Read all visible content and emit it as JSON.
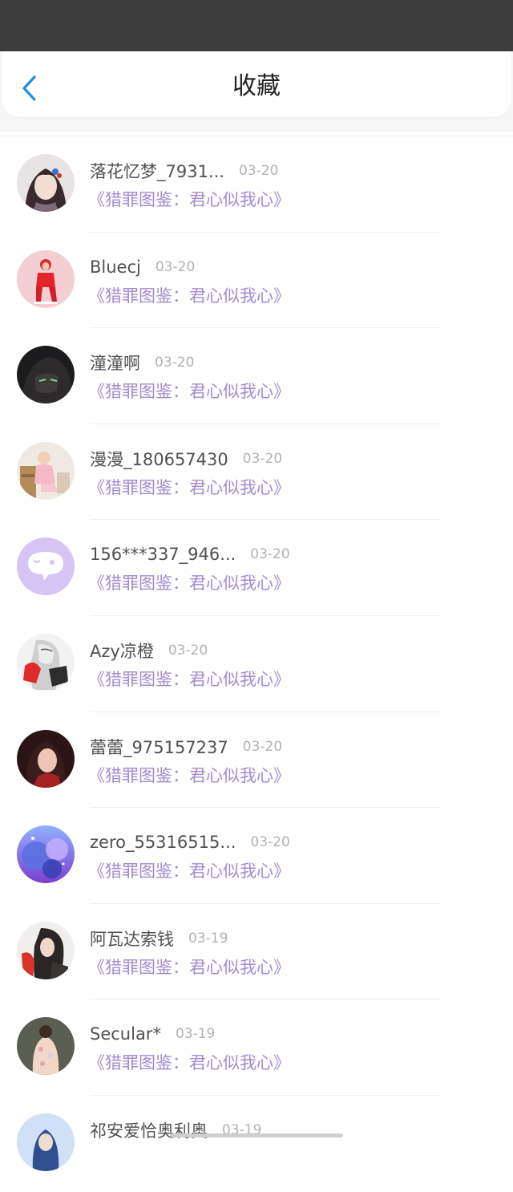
{
  "header": {
    "title": "收藏"
  },
  "colors": {
    "accent": "#1e90e8",
    "link": "#a48bd0",
    "status_bar": "#3d3d3d"
  },
  "items": [
    {
      "name": "落花忆梦_7931...",
      "date": "03-20",
      "book": "《猎罪图鉴：君心似我心》",
      "avatar_icon": "anime-girl-avatar"
    },
    {
      "name": "Bluecj",
      "date": "03-20",
      "book": "《猎罪图鉴：君心似我心》",
      "avatar_icon": "red-outfit-avatar"
    },
    {
      "name": "潼潼啊",
      "date": "03-20",
      "book": "《猎罪图鉴：君心似我心》",
      "avatar_icon": "dark-portrait-avatar"
    },
    {
      "name": "漫漫_180657430",
      "date": "03-20",
      "book": "《猎罪图鉴：君心似我心》",
      "avatar_icon": "child-photo-avatar"
    },
    {
      "name": "156***337_946...",
      "date": "03-20",
      "book": "《猎罪图鉴：君心似我心》",
      "avatar_icon": "default-chat-bubble-avatar"
    },
    {
      "name": "Azy凉橙",
      "date": "03-20",
      "book": "《猎罪图鉴：君心似我心》",
      "avatar_icon": "sketch-art-avatar"
    },
    {
      "name": "蕾蕾_975157237",
      "date": "03-20",
      "book": "《猎罪图鉴：君心似我心》",
      "avatar_icon": "woman-photo-avatar"
    },
    {
      "name": "zero_55316515...",
      "date": "03-20",
      "book": "《猎罪图鉴：君心似我心》",
      "avatar_icon": "galaxy-bubble-avatar"
    },
    {
      "name": "阿瓦达索钱",
      "date": "03-19",
      "book": "《猎罪图鉴：君心似我心》",
      "avatar_icon": "illustration-avatar"
    },
    {
      "name": "Secular*",
      "date": "03-19",
      "book": "《猎罪图鉴：君心似我心》",
      "avatar_icon": "floral-avatar"
    },
    {
      "name": "祁安爱恰奥利奥",
      "date": "03-19",
      "book": "",
      "avatar_icon": "blue-avatar"
    }
  ]
}
